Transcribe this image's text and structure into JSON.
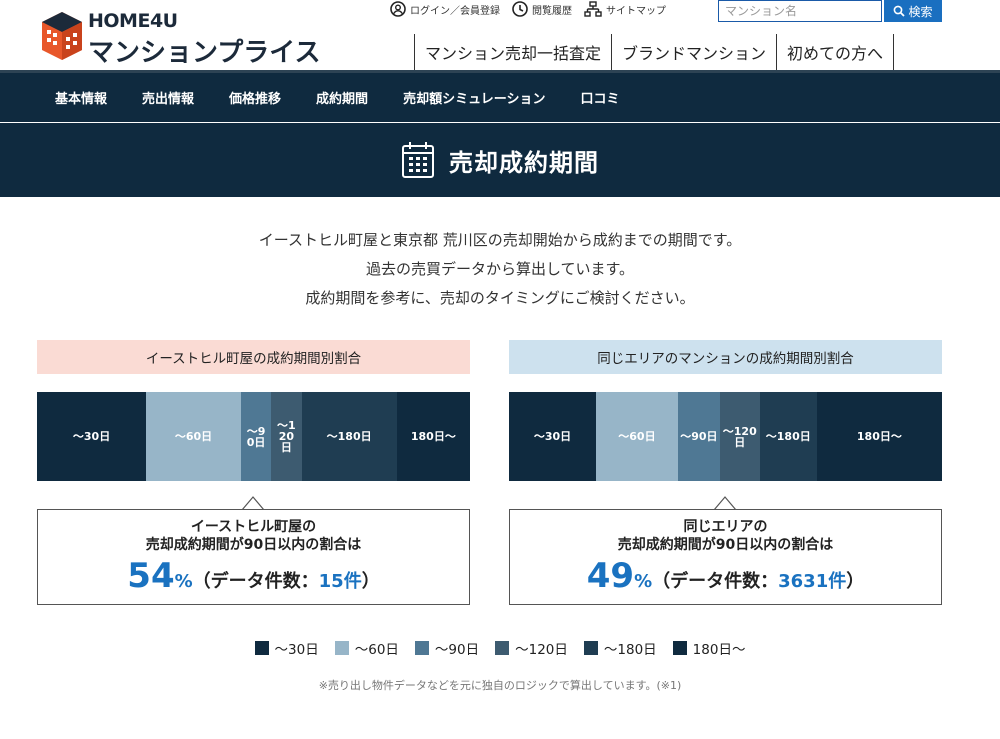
{
  "brand": {
    "en": "HOME4U",
    "ja": "マンションプライス"
  },
  "util_links": [
    "ログイン／会員登録",
    "閲覧履歴",
    "サイトマップ"
  ],
  "search": {
    "placeholder": "マンション名",
    "button": "検索"
  },
  "topnav": [
    "マンション売却一括査定",
    "ブランドマンション",
    "初めての方へ"
  ],
  "subnav": [
    "基本情報",
    "売出情報",
    "価格推移",
    "成約期間",
    "売却額シミュレーション",
    "口コミ"
  ],
  "title": "売却成約期間",
  "intro": [
    "イーストヒル町屋と東京都 荒川区の売却開始から成約までの期間です。",
    "過去の売買データから算出しています。",
    "成約期間を参考に、売却のタイミングにご検討ください。"
  ],
  "left": {
    "header": "イーストヒル町屋の成約期間別割合",
    "line1": "イーストヒル町屋の",
    "line2": "売却成約期間が90日以内の割合は",
    "percent": "54",
    "percent_unit": "%",
    "count_prefix": "（データ件数：",
    "count": "15件",
    "count_suffix": "）"
  },
  "right": {
    "header": "同じエリアのマンションの成約期間別割合",
    "line1": "同じエリアの",
    "line2": "売却成約期間が90日以内の割合は",
    "percent": "49",
    "percent_unit": "%",
    "count_prefix": "（データ件数：",
    "count": "3631件",
    "count_suffix": "）"
  },
  "chart_data": [
    {
      "type": "bar",
      "categories": [
        "〜30日",
        "〜60日",
        "〜90日",
        "〜120日",
        "〜180日",
        "180日〜"
      ],
      "values": [
        25.2,
        21.9,
        7.0,
        7.0,
        22.0,
        16.9
      ],
      "labels": [
        "〜30日",
        "〜60日",
        "〜90日",
        "〜120日",
        "〜180日",
        "180日〜"
      ]
    },
    {
      "type": "bar",
      "categories": [
        "〜30日",
        "〜60日",
        "〜90日",
        "〜120日",
        "〜180日",
        "180日〜"
      ],
      "values": [
        20.1,
        18.9,
        9.7,
        9.2,
        13.2,
        28.9
      ],
      "labels": [
        "〜30日",
        "〜60日",
        "〜90日",
        "〜120日",
        "〜180日",
        "180日〜"
      ]
    }
  ],
  "segment_colors": [
    "#0f2a3f",
    "#97b5c8",
    "#4f7894",
    "#3d5b70",
    "#1f3d52",
    "#0f2a3f"
  ],
  "legend": [
    "〜30日",
    "〜60日",
    "〜90日",
    "〜120日",
    "〜180日",
    "180日〜"
  ],
  "note": "※売り出し物件データなどを元に独自のロジックで算出しています。(※1)"
}
